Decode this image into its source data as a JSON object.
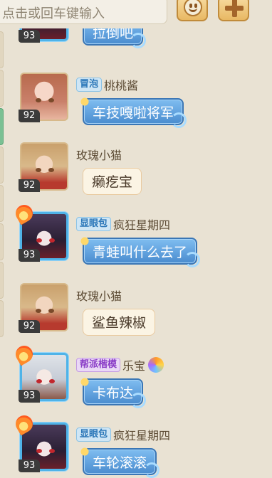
{
  "input": {
    "placeholder": "点击或回车键输入",
    "visible_text": "点击或回车键输入"
  },
  "toolbar": {
    "emoji_icon": "smiley-icon",
    "plus_icon": "plus-icon"
  },
  "colors": {
    "background": "#e9e2d3",
    "bubble_blue": "#4a8ccf",
    "badge_blue": "#2a76b8",
    "badge_purple": "#8a3dc7",
    "level_bg": "#3b3b3b"
  },
  "messages": [
    {
      "level": "93",
      "badge": "",
      "name": "",
      "text": "拉倒吧",
      "style": "blue"
    },
    {
      "level": "92",
      "badge": "冒泡",
      "name": "桃桃酱",
      "text": "车技嘎啦将军",
      "style": "blue"
    },
    {
      "level": "92",
      "badge": "",
      "name": "玫瑰小猫",
      "text": "癞疙宝",
      "style": "plain"
    },
    {
      "level": "93",
      "badge": "显眼包",
      "name": "疯狂星期四",
      "text": "青蛙叫什么去了",
      "style": "blue"
    },
    {
      "level": "92",
      "badge": "",
      "name": "玫瑰小猫",
      "text": "鲨鱼辣椒",
      "style": "plain"
    },
    {
      "level": "93",
      "badge": "帮派楷模",
      "name": "乐宝",
      "text": "卡布达",
      "style": "blue"
    },
    {
      "level": "93",
      "badge": "显眼包",
      "name": "疯狂星期四",
      "text": "车轮滚滚",
      "style": "blue"
    }
  ]
}
